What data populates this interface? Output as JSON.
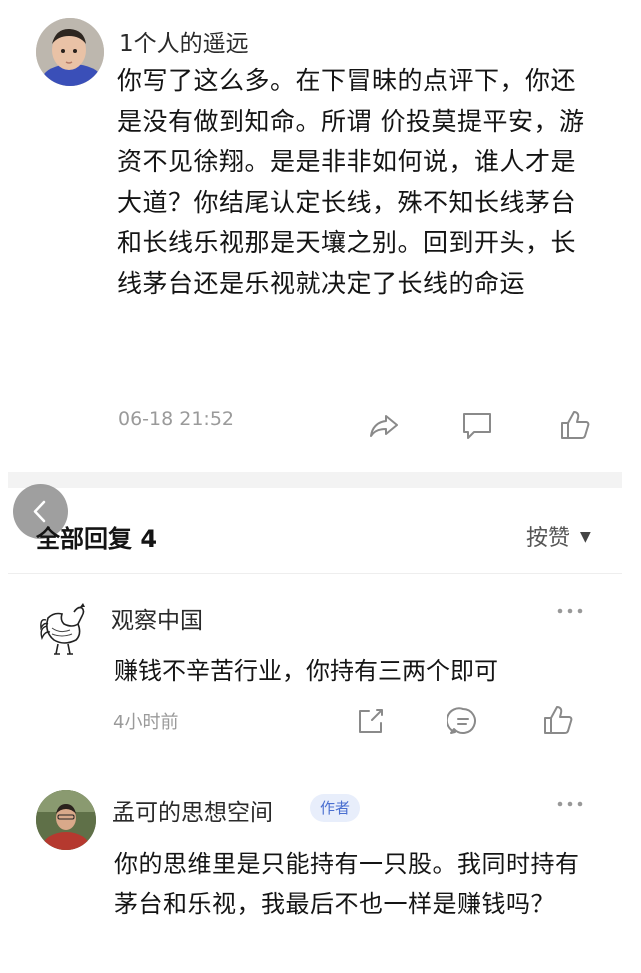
{
  "main_comment": {
    "username": "1个人的遥远",
    "body": "你写了这么多。在下冒昧的点评下，你还是没有做到知命。所谓 价投莫提平安，游资不见徐翔。是是非非如何说，谁人才是大道？你结尾认定长线，殊不知长线茅台和长线乐视那是天壤之别。回到开头，长线茅台还是乐视就决定了长线的命运",
    "timestamp": "06-18 21:52",
    "icons": {
      "share": "share-arrow-icon",
      "comment": "comment-bubble-icon",
      "like": "thumbs-up-icon"
    }
  },
  "replies_section": {
    "title": "全部回复 4",
    "sort_label": "按赞",
    "sort_icon": "caret-down-icon"
  },
  "replies": [
    {
      "username": "观察中国",
      "text": "赚钱不辛苦行业，你持有三两个即可",
      "timestamp": "4小时前",
      "icons": {
        "more": "more-dots-icon",
        "share": "share-box-icon",
        "reply": "reply-bubble-icon",
        "like": "thumbs-up-icon"
      }
    },
    {
      "username": "孟可的思想空间",
      "badge": "作者",
      "text": "你的思维里是只能持有一只股。我同时持有茅台和乐视，我最后不也一样是赚钱吗？",
      "icons": {
        "more": "more-dots-icon"
      }
    }
  ],
  "colors": {
    "text": "#141414",
    "muted": "#9a9a9a",
    "icon": "#888888",
    "badge_bg": "#e8eefb",
    "badge_text": "#4a6fd0"
  }
}
